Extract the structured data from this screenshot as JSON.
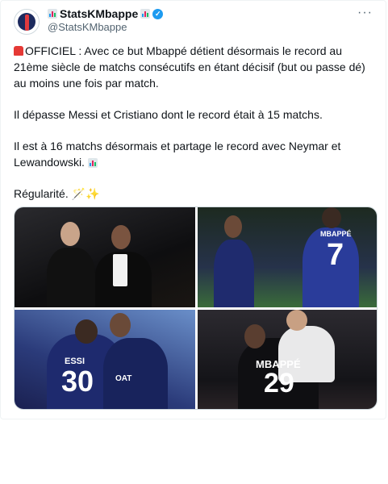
{
  "tweet": {
    "display_name": "StatsKMbappe",
    "handle": "@StatsKMbappe",
    "more_label": "···",
    "verified_mark": "✓",
    "paragraphs": [
      "OFFICIEL : Avec ce but Mbappé détient désormais le record au 21ème siècle de matchs consécutifs en étant décisif (but ou passe dé) au moins une fois par match.",
      "Il dépasse Messi et Cristiano dont le record était à 15 matchs.",
      "Il est à 16 matchs désormais et partage le record avec Neymar et Lewandowski.",
      "Régularité. 🪄✨"
    ],
    "icons": [
      "siren-emoji",
      "chart-emoji",
      "verified-badge",
      "magic-wand-emoji",
      "sparkles-emoji"
    ],
    "media": {
      "jersey_texts": [
        "MBAPPÉ",
        "7",
        "ESSI",
        "30",
        "OAT",
        "MBAPPÉ",
        "29"
      ]
    }
  }
}
